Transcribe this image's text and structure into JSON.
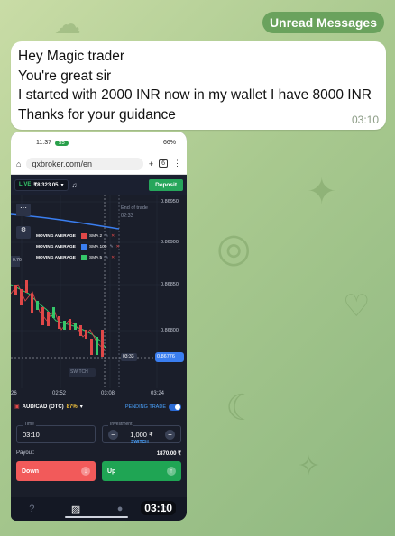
{
  "unread": {
    "label": "Unread Messages"
  },
  "message": {
    "lines": [
      "Hey Magic trader",
      "You're great sir",
      "I started with 2000 INR now in my wallet I have 8000 INR",
      "Thanks for your guidance"
    ],
    "time": "03:10"
  },
  "screenshot": {
    "status_time": "11:37",
    "status_pill": "55",
    "battery": "66%",
    "url": "qxbroker.com/en",
    "tab_count": "6",
    "live_label": "LIVE",
    "balance": "₹8,323.05",
    "deposit_label": "Deposit",
    "chart_prices": [
      "0.86950",
      "0.86900",
      "0.86850",
      "0.86800"
    ],
    "current_price": "0.86776",
    "chart_times": [
      "26",
      "02:52",
      "03:08",
      "03:24"
    ],
    "time_marker": "03:33",
    "end_trade_lines": [
      "End of trade",
      "02:33"
    ],
    "indicators": [
      {
        "name": "MOVING AVERAGE",
        "value": "SMA 2",
        "color": "#e04848"
      },
      {
        "name": "MOVING AVERAGE",
        "value": "SMA 100",
        "color": "#3a7ef0"
      },
      {
        "name": "MOVING AVERAGE",
        "value": "SMA 5",
        "color": "#35c76a"
      }
    ],
    "pair": "AUD/CAD (OTC)",
    "pair_pct": "87%",
    "pending_label": "PENDING TRADE",
    "time_label": "Time",
    "time_value": "03:10",
    "investment_label": "Investment",
    "investment_value": "1,000 ₹",
    "switch_label": "SWITCH",
    "payout_label": "Payout:",
    "payout_value": "1870.00 ₹",
    "down_label": "Down",
    "up_label": "Up",
    "overlay_time": "03:10",
    "side_label": "0.76"
  },
  "colors": {
    "down": "#f25a5a",
    "up": "#1fa554",
    "accent": "#2b6bd6"
  }
}
